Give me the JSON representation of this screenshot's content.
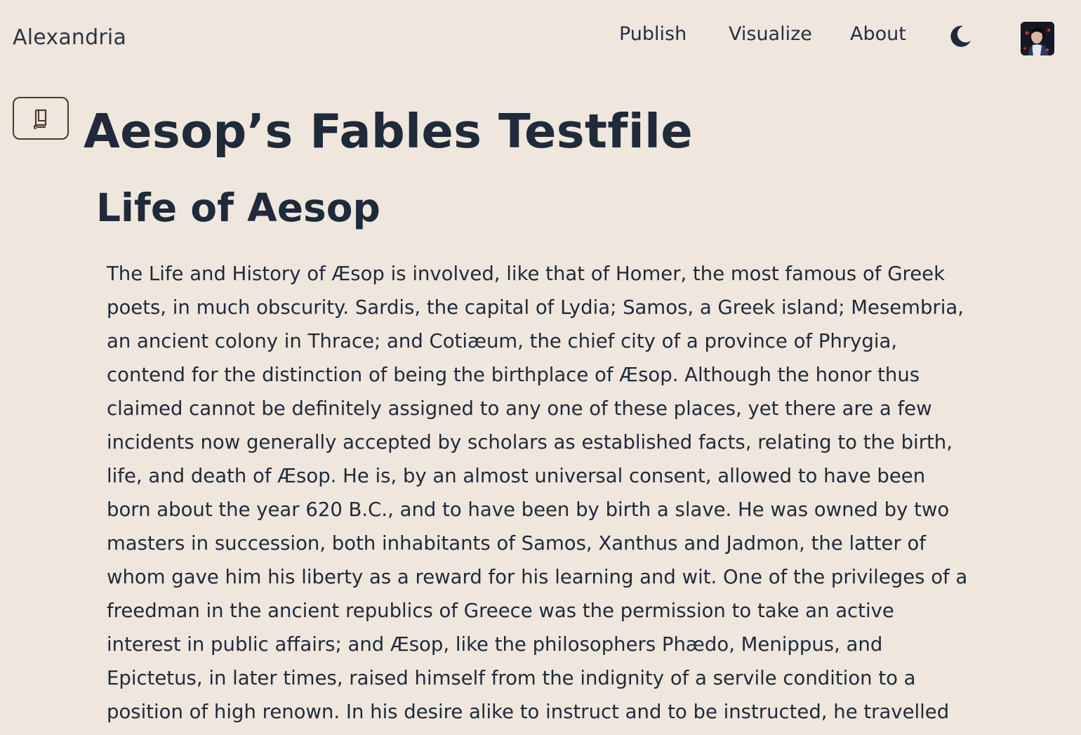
{
  "header": {
    "brand": "Alexandria",
    "nav": {
      "publish": "Publish",
      "visualize": "Visualize",
      "about": "About"
    },
    "icons": {
      "theme": "moon-icon",
      "toc": "book-icon",
      "avatar": "avatar"
    }
  },
  "main": {
    "title": "Aesop’s Fables Testfile",
    "section_title": "Life of Aesop",
    "paragraph_lines": [
      "The Life and History of Æsop is involved, like that of Homer, the most famous of Greek",
      "poets, in much obscurity. Sardis, the capital of Lydia; Samos, a Greek island; Mesembria,",
      "an ancient colony in Thrace; and Cotiæum, the chief city of a province of Phrygia,",
      "contend for the distinction of being the birthplace of Æsop. Although the honor thus",
      "claimed cannot be definitely assigned to any one of these places, yet there are a few",
      "incidents now generally accepted by scholars as established facts, relating to the birth,",
      "life, and death of Æsop. He is, by an almost universal consent, allowed to have been",
      "born about the year 620 B.C., and to have been by birth a slave. He was owned by two",
      "masters in succession, both inhabitants of Samos, Xanthus and Jadmon, the latter of",
      "whom gave him his liberty as a reward for his learning and wit. One of the privileges of a",
      "freedman in the ancient republics of Greece was the permission to take an active",
      "interest in public affairs; and Æsop, like the philosophers Phædo, Menippus, and",
      "Epictetus, in later times, raised himself from the indignity of a servile condition to a",
      "position of high renown. In his desire alike to instruct and to be instructed, he travelled"
    ]
  },
  "colors": {
    "background": "#efe7dd",
    "text": "#1f2a3a",
    "button_border": "#4a3a2a"
  }
}
